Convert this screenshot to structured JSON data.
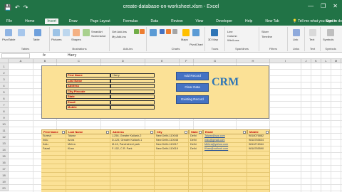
{
  "window": {
    "title": "create-database-on-worksheet.xlsm - Excel",
    "minimize_glyph": "—",
    "restore_glyph": "❐",
    "close_glyph": "✕"
  },
  "quick_access": {
    "save_glyph": "💾",
    "undo_glyph": "↶",
    "redo_glyph": "↷"
  },
  "tabs": [
    "File",
    "Home",
    "Insert",
    "Draw",
    "Page Layout",
    "Formulas",
    "Data",
    "Review",
    "View",
    "Developer",
    "Help",
    "New Tab"
  ],
  "active_tab": "Insert",
  "tell_me": "Tell me what you want to do",
  "sign_in": "Sign in",
  "ribbon": {
    "groups": [
      "Tables",
      "Illustrations",
      "Add-ins",
      "Charts",
      "Tours",
      "Sparklines",
      "Filters",
      "Links",
      "Text",
      "Symbols"
    ],
    "buttons": {
      "pivot": "PivotTable",
      "recommended": "Recommended PivotTables",
      "table": "Table",
      "pictures": "Pictures",
      "online_pictures": "Online Pictures",
      "shapes": "Shapes",
      "icons": "Icons",
      "models_3d": "3D Models",
      "smartart": "SmartArt",
      "screenshot": "Screenshot",
      "get_addins": "Get Add-ins",
      "my_addins": "My Add-ins",
      "bing_maps": "Bing Maps",
      "people_graph": "People Graph",
      "rec_charts": "Recommended Charts",
      "maps": "Maps",
      "pivotchart": "PivotChart",
      "map3d": "3D Map",
      "line": "Line",
      "column": "Column",
      "winloss": "Win/Loss",
      "slicer": "Slicer",
      "timeline": "Timeline",
      "link": "Link",
      "text": "Text",
      "symbols": "Symbols"
    }
  },
  "formula_bar": {
    "name_box": "",
    "fx": "fx",
    "value": "Harry"
  },
  "sheet": {
    "columns": [
      "A",
      "B",
      "C",
      "D",
      "E",
      "F",
      "G",
      "H",
      "I",
      "J",
      "K",
      "L",
      "M",
      "N"
    ],
    "rows": [
      "1",
      "2",
      "3",
      "4",
      "5",
      "6",
      "7",
      "8",
      "9",
      "10",
      "11",
      "12",
      "13",
      "14",
      "15",
      "16",
      "17",
      "18",
      "19",
      "20"
    ]
  },
  "form": {
    "labels": [
      "First Name",
      "Last Name",
      "Address",
      "City-Pincode",
      "State",
      "Email",
      "Mobile"
    ],
    "first_name_value": "Harry",
    "buttons": {
      "add": "Add Record",
      "clear": "Clear Data",
      "existing": "Existing Record"
    },
    "brand": "CRM"
  },
  "table": {
    "headers": [
      "First Name",
      "Last Name",
      "Address",
      "City",
      "State",
      "Email",
      "Mobile"
    ],
    "rows": [
      [
        "Suresh",
        "Talwar",
        "J-256, Greater Kailash-2",
        "New Delhi-110048",
        "Delhi",
        "Talwar@xyz.com",
        "9818076882"
      ],
      [
        "Indu",
        "Arora",
        "D-125, Greater Kailash-1",
        "New Delhi-110048",
        "Delhi",
        "Indu@gmail.com",
        "9818765634"
      ],
      [
        "Kalu",
        "Mehra",
        "M-16, Panchsheel park",
        "New Delhi-110017",
        "Delhi",
        "Mehra@yahoo.com",
        "9811274564"
      ],
      [
        "Faizal",
        "Khan",
        "F-102, C.R. Park",
        "New Delhi-110019",
        "Delhi",
        "Khan@outlook.com",
        "9818765590"
      ]
    ]
  },
  "colors": {
    "excel_green": "#217346",
    "form_fill": "#fbe196",
    "button_blue": "#4472c4",
    "label_red": "#c00000",
    "crm_blue": "#2e75b6"
  }
}
